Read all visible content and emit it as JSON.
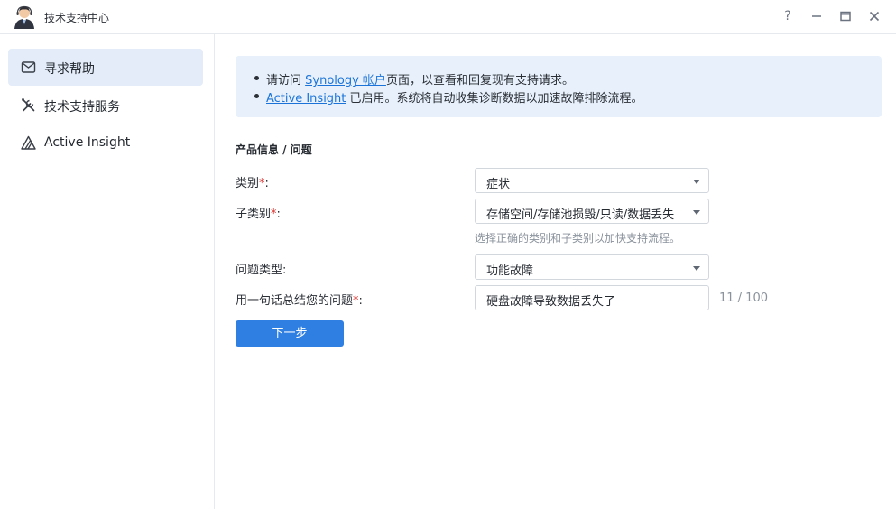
{
  "window": {
    "title": "技术支持中心",
    "controls": [
      "?",
      "—",
      "▭",
      "✕"
    ]
  },
  "sidebar": {
    "items": [
      {
        "label": "寻求帮助",
        "icon": "mail-icon",
        "active": true
      },
      {
        "label": "技术支持服务",
        "icon": "tools-icon",
        "active": false
      },
      {
        "label": "Active Insight",
        "icon": "active-insight-icon",
        "active": false
      }
    ]
  },
  "notice": {
    "line1": {
      "before": "请访问 ",
      "link": "Synology 帐户",
      "after": "页面，以查看和回复现有支持请求。"
    },
    "line2": {
      "link": "Active Insight",
      "after": " 已启用。系统将自动收集诊断数据以加速故障排除流程。"
    }
  },
  "form": {
    "section_title": "产品信息 / 问题",
    "category": {
      "label": "类别",
      "required_mark": "*",
      "colon": ":",
      "value": "症状"
    },
    "subcategory": {
      "label": "子类别",
      "required_mark": "*",
      "colon": ":",
      "value": "存储空间/存储池损毁/只读/数据丢失",
      "hint": "选择正确的类别和子类别以加快支持流程。"
    },
    "issue_type": {
      "label": "问题类型:",
      "value": "功能故障"
    },
    "summary": {
      "label": "用一句话总结您的问题",
      "required_mark": "*",
      "colon": ":",
      "value": "硬盘故障导致数据丢失了",
      "counter": "11 / 100"
    },
    "next_button": "下一步"
  },
  "colors": {
    "accent": "#2f7ee2",
    "link": "#1a73d9",
    "notice_bg": "#e7f0fb",
    "active_nav_bg": "#e3ecf8",
    "required": "#e0342f"
  }
}
